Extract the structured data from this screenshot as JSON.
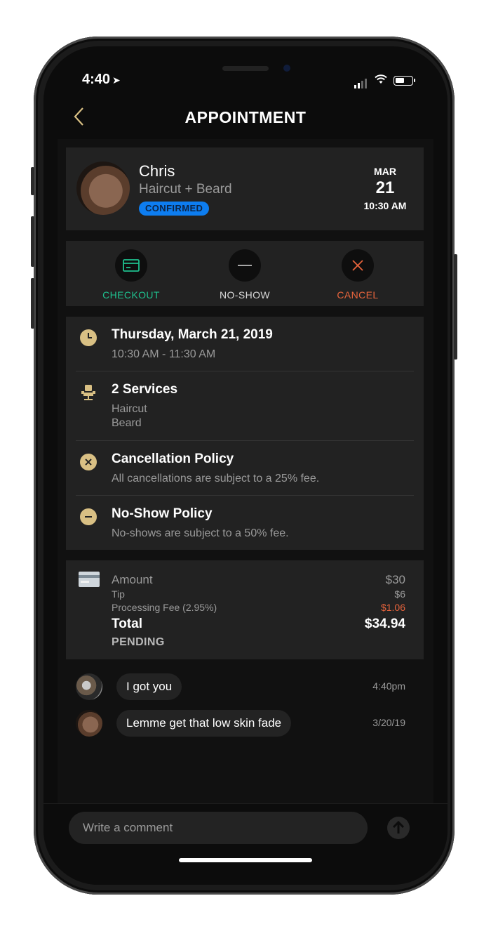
{
  "status": {
    "time": "4:40"
  },
  "header": {
    "title": "APPOINTMENT"
  },
  "appointment": {
    "client_name": "Chris",
    "service": "Haircut + Beard",
    "status_badge": "CONFIRMED",
    "month": "MAR",
    "day": "21",
    "time": "10:30 AM"
  },
  "actions": [
    {
      "label": "CHECKOUT",
      "icon": "card-icon",
      "color": "#1fc08e"
    },
    {
      "label": "NO-SHOW",
      "icon": "minus-icon",
      "color": "#d8d8d8"
    },
    {
      "label": "CANCEL",
      "icon": "close-icon",
      "color": "#e8643c"
    }
  ],
  "details": {
    "date": {
      "title": "Thursday, March 21, 2019",
      "sub": "10:30 AM - 11:30 AM"
    },
    "services": {
      "title": "2 Services",
      "items": [
        "Haircut",
        "Beard"
      ]
    },
    "cancellation": {
      "title": "Cancellation Policy",
      "sub": "All cancellations are subject to a 25% fee."
    },
    "noshow": {
      "title": "No-Show Policy",
      "sub": "No-shows are subject to a 50% fee."
    }
  },
  "payment": {
    "amount_label": "Amount",
    "amount": "$30",
    "tip_label": "Tip",
    "tip": "$6",
    "fee_label": "Processing Fee (2.95%)",
    "fee": "$1.06",
    "total_label": "Total",
    "total": "$34.94",
    "status": "PENDING"
  },
  "messages": [
    {
      "text": "I got you",
      "time": "4:40pm"
    },
    {
      "text": "Lemme get that low skin fade",
      "time": "3/20/19"
    }
  ],
  "composer": {
    "placeholder": "Write a comment"
  },
  "colors": {
    "accent": "#d9c084",
    "badge": "#0d7df0",
    "checkout": "#1fc08e",
    "cancel": "#e8643c",
    "fee": "#e8643c"
  }
}
